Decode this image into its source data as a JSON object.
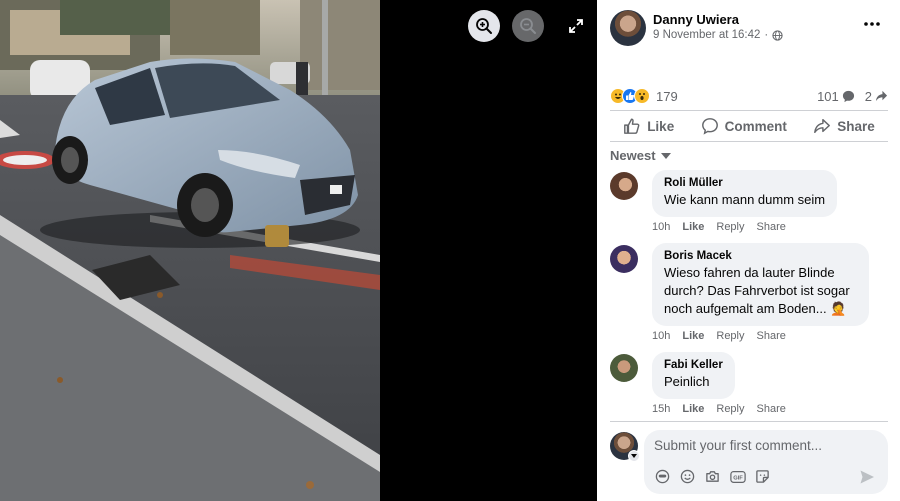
{
  "viewer": {
    "zoom_in_icon": "zoom-in-icon",
    "zoom_out_icon": "zoom-out-icon",
    "fullscreen_icon": "fullscreen-icon"
  },
  "post": {
    "author": "Danny Uwiera",
    "date": "9 November at 16:42",
    "separator": "·",
    "audience_icon": "globe-icon",
    "more_icon": "more-horizontal-icon"
  },
  "reactions": {
    "types": [
      "haha",
      "like",
      "wow"
    ],
    "count": "179",
    "comments_count": "101",
    "shares_count": "2"
  },
  "actions": {
    "like": "Like",
    "comment": "Comment",
    "share": "Share"
  },
  "sort": {
    "label": "Newest"
  },
  "comments": [
    {
      "author": "Roli Müller",
      "text": "Wie kann mann dumm seim",
      "time": "10h",
      "like": "Like",
      "reply": "Reply",
      "share": "Share"
    },
    {
      "author": "Boris Macek",
      "text": "Wieso fahren da lauter Blinde durch? Das Fahrverbot ist sogar noch aufgemalt am Boden... 🤦",
      "time": "10h",
      "like": "Like",
      "reply": "Reply",
      "share": "Share"
    },
    {
      "author": "Fabi Keller",
      "text": "Peinlich",
      "time": "15h",
      "like": "Like",
      "reply": "Reply",
      "share": "Share"
    }
  ],
  "composer": {
    "placeholder": "Submit your first comment..."
  },
  "colors": {
    "accent": "#1877f2",
    "secondary_text": "#65676b",
    "bubble": "#f0f2f5"
  }
}
